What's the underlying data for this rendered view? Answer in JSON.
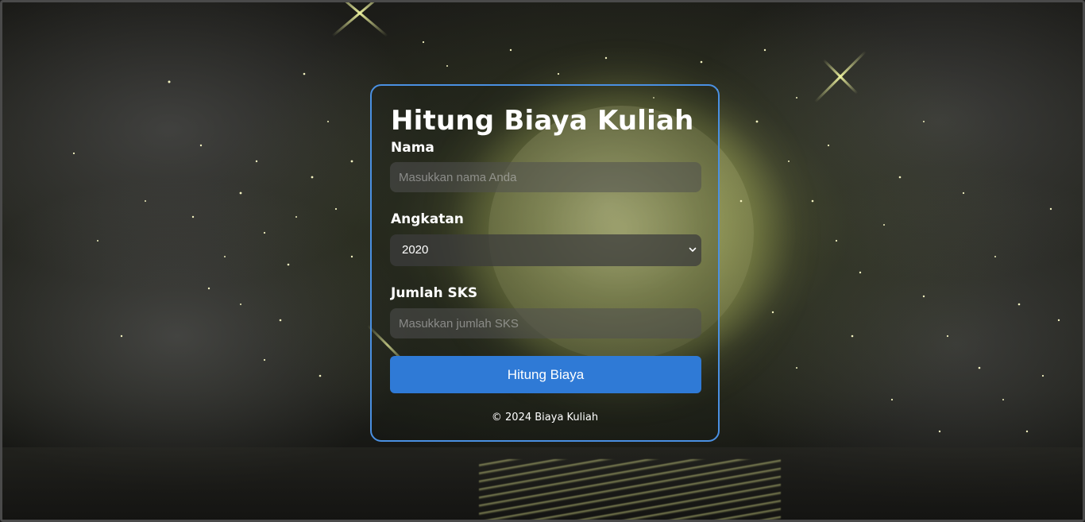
{
  "page": {
    "title": "Hitung Biaya Kuliah",
    "footer": "© 2024 Biaya Kuliah"
  },
  "form": {
    "nama": {
      "label": "Nama",
      "placeholder": "Masukkan nama Anda",
      "value": ""
    },
    "angkatan": {
      "label": "Angkatan",
      "selected": "2020"
    },
    "sks": {
      "label": "Jumlah SKS",
      "placeholder": "Masukkan jumlah SKS",
      "value": ""
    },
    "submit_label": "Hitung Biaya"
  },
  "colors": {
    "accent": "#2f7ad6",
    "card_border": "#4a90e2",
    "text": "#ffffff"
  },
  "icons": {
    "select_arrow": "chevron-down-icon"
  }
}
